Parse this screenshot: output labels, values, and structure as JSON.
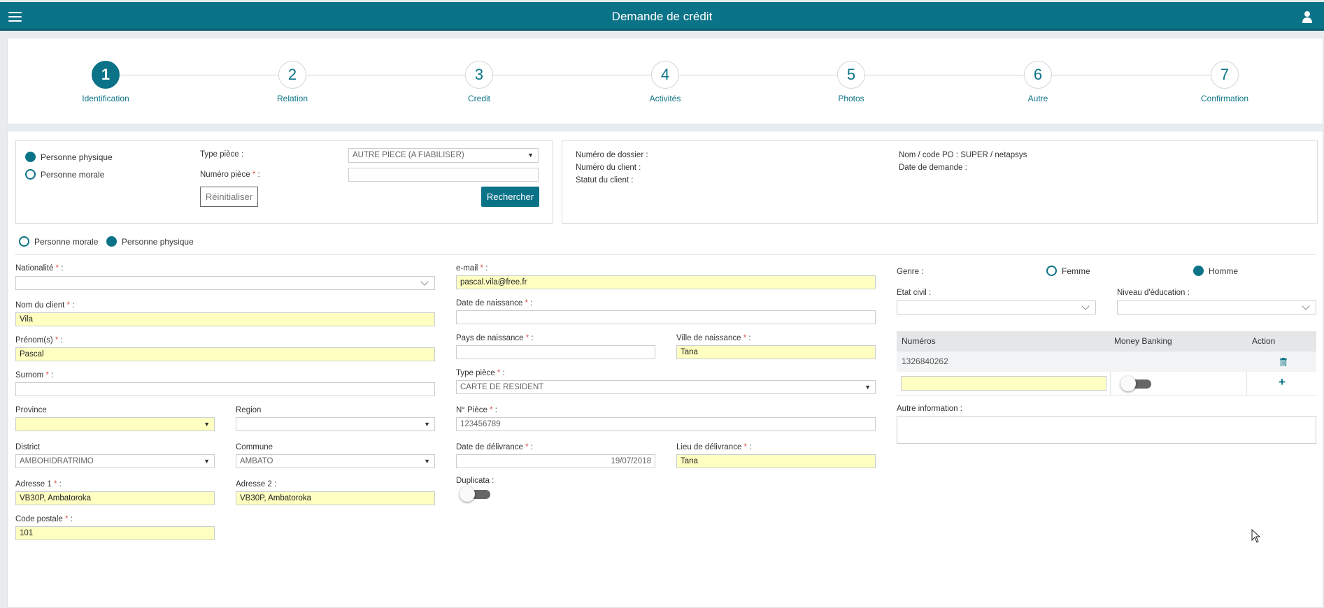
{
  "header": {
    "title": "Demande de crédit"
  },
  "steps": [
    {
      "num": "1",
      "label": "Identification"
    },
    {
      "num": "2",
      "label": "Relation"
    },
    {
      "num": "3",
      "label": "Credit"
    },
    {
      "num": "4",
      "label": "Activités"
    },
    {
      "num": "5",
      "label": "Photos"
    },
    {
      "num": "6",
      "label": "Autre"
    },
    {
      "num": "7",
      "label": "Confirmation"
    }
  ],
  "search": {
    "person_physical": "Personne physique",
    "person_moral": "Personne morale",
    "type_piece_label": "Type pièce :",
    "type_piece_value": "AUTRE PIECE (A FIABILISER)",
    "numero_piece_label": "Numéro pièce",
    "reset_label": "Réinitialiser",
    "search_label": "Rechercher"
  },
  "dossier": {
    "numero_dossier": "Numéro de dossier :",
    "numero_client": "Numéro du client :",
    "statut_client": "Statut du client :",
    "nom_code_po": "Nom / code PO : SUPER / netapsys",
    "date_demande": "Date de demande :"
  },
  "person_type": {
    "moral": "Personne morale",
    "physical": "Personne physique"
  },
  "form": {
    "nationalite_label": "Nationalité",
    "nom_label": "Nom du client",
    "nom_value": "Vila",
    "prenom_label": "Prénom(s)",
    "prenom_value": "Pascal",
    "surnom_label": "Surnom",
    "province_label": "Province",
    "region_label": "Region",
    "district_label": "District",
    "district_value": "AMBOHIDRATRIMO",
    "commune_label": "Commune",
    "commune_value": "AMBATO",
    "adresse1_label": "Adresse 1",
    "adresse1_value": "VB30P, Ambatoroka",
    "adresse2_label": "Adresse 2 :",
    "adresse2_value": "VB30P, Ambatoroka",
    "code_postal_label": "Code postale",
    "code_postal_value": "101",
    "email_label": "e-mail",
    "email_value": "pascal.vila@free.fr",
    "date_naissance_label": "Date de naissance",
    "pays_naissance_label": "Pays de naissance",
    "ville_naissance_label": "Ville de naissance",
    "ville_naissance_value": "Tana",
    "type_piece_label": "Type pièce",
    "type_piece_value": "CARTE DE RESIDENT",
    "n_piece_label": "N° Pièce",
    "n_piece_value": "123456789",
    "date_delivrance_label": "Date de délivrance",
    "date_delivrance_value": "19/07/2018",
    "lieu_delivrance_label": "Lieu de délivrance",
    "lieu_delivrance_value": "Tana",
    "duplicata_label": "Duplicata :",
    "genre_label": "Genre :",
    "femme": "Femme",
    "homme": "Homme",
    "etat_civil_label": "Etat civil :",
    "niveau_education_label": "Niveau d'éducation :",
    "autre_info_label": "Autre information :"
  },
  "phones": {
    "headers": [
      "Numéros",
      "Money Banking",
      "Action"
    ],
    "rows": [
      {
        "numero": "1326840262"
      }
    ],
    "add_symbol": "+"
  },
  "colors": {
    "primary": "#0b7387",
    "required_field": "#ffffc2",
    "required_star": "#d9534f"
  }
}
